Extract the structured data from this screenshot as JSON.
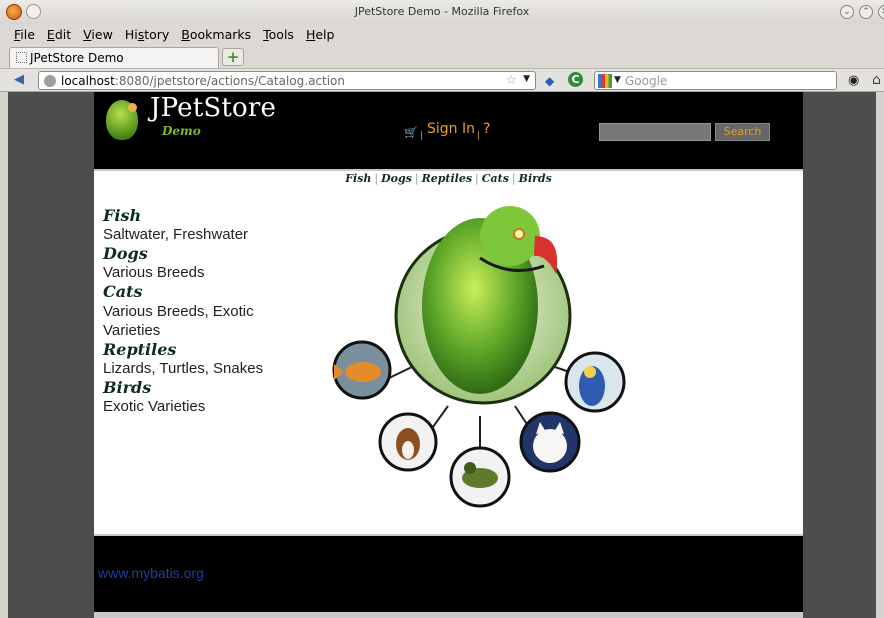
{
  "window": {
    "title": "JPetStore Demo - Mozilla Firefox"
  },
  "menubar": {
    "items": [
      {
        "label": "File",
        "u": "F",
        "rest": "ile"
      },
      {
        "label": "Edit",
        "u": "E",
        "rest": "dit"
      },
      {
        "label": "View",
        "u": "V",
        "rest": "iew"
      },
      {
        "label": "History",
        "u": "H",
        "rest": "istory"
      },
      {
        "label": "Bookmarks",
        "u": "B",
        "rest": "ookmarks"
      },
      {
        "label": "Tools",
        "u": "T",
        "rest": "ools"
      },
      {
        "label": "Help",
        "u": "H",
        "rest": "elp"
      }
    ]
  },
  "tabs": {
    "active_label": "JPetStore Demo",
    "new_tab_label": "+"
  },
  "address": {
    "host": "localhost",
    "path": ":8080/jpetstore/actions/Catalog.action"
  },
  "search_engine": {
    "placeholder": "Google"
  },
  "site": {
    "logo_title": "JPetStore",
    "logo_subtitle": "Demo",
    "sign_in": "Sign In",
    "help": "?",
    "search_button": "Search",
    "quicklinks": [
      "Fish",
      "Dogs",
      "Reptiles",
      "Cats",
      "Birds"
    ],
    "categories": [
      {
        "name": "Fish",
        "desc": "Saltwater, Freshwater"
      },
      {
        "name": "Dogs",
        "desc": "Various Breeds"
      },
      {
        "name": "Cats",
        "desc": "Various Breeds, Exotic Varieties"
      },
      {
        "name": "Reptiles",
        "desc": "Lizards, Turtles, Snakes"
      },
      {
        "name": "Birds",
        "desc": "Exotic Varieties"
      }
    ],
    "footer_link": "www.mybatis.org"
  },
  "colors": {
    "accent": "#e5a21d",
    "category_text": "#0d2b1e",
    "footer_link": "#1f3f9e"
  }
}
